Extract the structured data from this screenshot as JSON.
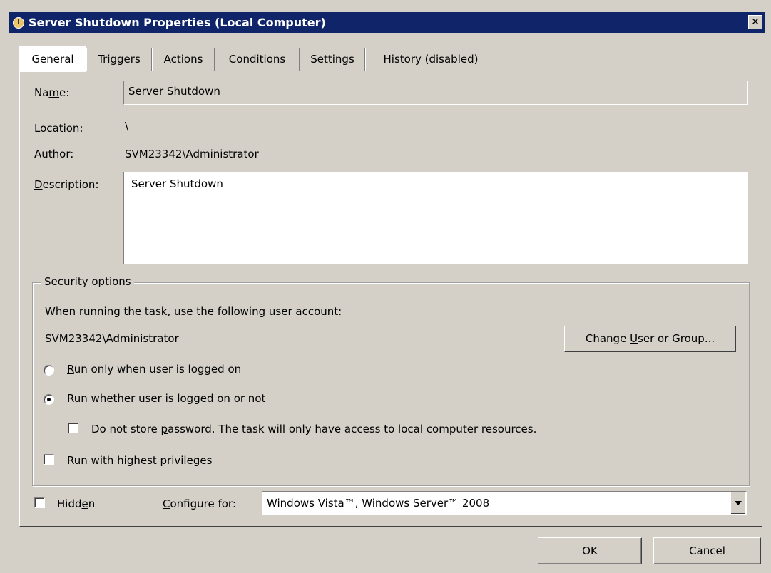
{
  "window": {
    "title": "Server Shutdown Properties (Local Computer)",
    "close_label": "✕"
  },
  "tabs": [
    {
      "label": "General",
      "active": true
    },
    {
      "label": "Triggers"
    },
    {
      "label": "Actions"
    },
    {
      "label": "Conditions"
    },
    {
      "label": "Settings"
    },
    {
      "label": "History (disabled)"
    }
  ],
  "general": {
    "name_label_pre": "Na",
    "name_label_u": "m",
    "name_label_post": "e:",
    "name_value": "Server Shutdown",
    "location_label": "Location:",
    "location_value": "\\",
    "author_label": "Author:",
    "author_value": "SVM23342\\Administrator",
    "description_label_u": "D",
    "description_label_post": "escription:",
    "description_value": "Server Shutdown"
  },
  "security": {
    "group_title": "Security options",
    "account_prompt": "When running the task, use the following user account:",
    "account_value": "SVM23342\\Administrator",
    "change_button_pre": "Change ",
    "change_button_u": "U",
    "change_button_post": "ser or Group...",
    "run_logged_on_u": "R",
    "run_logged_on_post": "un only when user is logged on",
    "run_whether_pre": "Run ",
    "run_whether_u": "w",
    "run_whether_post": "hether user is logged on or not",
    "do_not_store_pre": "Do not store ",
    "do_not_store_u": "p",
    "do_not_store_post": "assword.  The task will only have access to local computer resources.",
    "highest_pre": "Run w",
    "highest_u": "i",
    "highest_post": "th highest privileges"
  },
  "bottom": {
    "hidden_pre": "Hidd",
    "hidden_u": "e",
    "hidden_post": "n",
    "configure_u": "C",
    "configure_post": "onfigure for:",
    "configure_value": "Windows Vista™, Windows Server™ 2008",
    "ok_label": "OK",
    "cancel_label": "Cancel"
  }
}
